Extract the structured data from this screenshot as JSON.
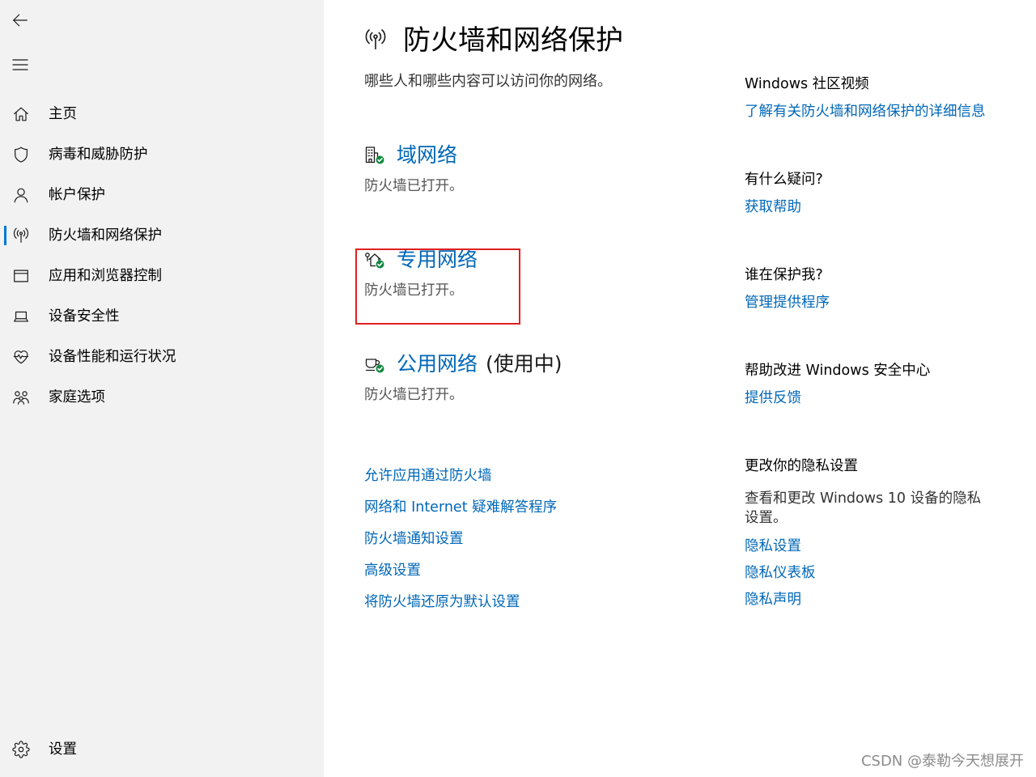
{
  "header": {
    "back_icon": "back-arrow-icon",
    "menu_icon": "hamburger-menu-icon"
  },
  "sidebar": {
    "items": [
      {
        "label": "主页",
        "icon": "home-icon"
      },
      {
        "label": "病毒和威胁防护",
        "icon": "shield-icon"
      },
      {
        "label": "帐户保护",
        "icon": "person-icon"
      },
      {
        "label": "防火墙和网络保护",
        "icon": "firewall-antenna-icon",
        "selected": true
      },
      {
        "label": "应用和浏览器控制",
        "icon": "app-browser-window-icon"
      },
      {
        "label": "设备安全性",
        "icon": "laptop-icon"
      },
      {
        "label": "设备性能和运行状况",
        "icon": "heart-pulse-icon"
      },
      {
        "label": "家庭选项",
        "icon": "family-icon"
      }
    ],
    "settings": {
      "label": "设置",
      "icon": "gear-icon"
    }
  },
  "main": {
    "title": "防火墙和网络保护",
    "title_icon": "firewall-antenna-icon",
    "subtitle": "哪些人和哪些内容可以访问你的网络。",
    "networks": [
      {
        "name": "域网络",
        "status": "防火墙已打开。",
        "icon": "domain-network-icon"
      },
      {
        "name": "专用网络",
        "status": "防火墙已打开。",
        "icon": "private-network-icon",
        "highlighted": true
      },
      {
        "name": "公用网络",
        "suffix": "(使用中)",
        "status": "防火墙已打开。",
        "icon": "public-network-icon"
      }
    ],
    "links": [
      "允许应用通过防火墙",
      "网络和 Internet 疑难解答程序",
      "防火墙通知设置",
      "高级设置",
      "将防火墙还原为默认设置"
    ]
  },
  "aside": {
    "community": {
      "heading": "Windows 社区视频",
      "link": "了解有关防火墙和网络保护的详细信息"
    },
    "help": {
      "heading": "有什么疑问?",
      "link": "获取帮助"
    },
    "protector": {
      "heading": "谁在保护我?",
      "link": "管理提供程序"
    },
    "feedback": {
      "heading": "帮助改进 Windows 安全中心",
      "link": "提供反馈"
    },
    "privacy": {
      "heading": "更改你的隐私设置",
      "description": "查看和更改 Windows 10 设备的隐私设置。",
      "links": [
        "隐私设置",
        "隐私仪表板",
        "隐私声明"
      ]
    }
  },
  "watermark": "CSDN @泰勒今天想展开",
  "colors": {
    "accent": "#0078d7",
    "link": "#0067b8",
    "sidebar_bg": "#f2f2f2",
    "status_ok": "#10893e",
    "annotation": "#e02020"
  }
}
